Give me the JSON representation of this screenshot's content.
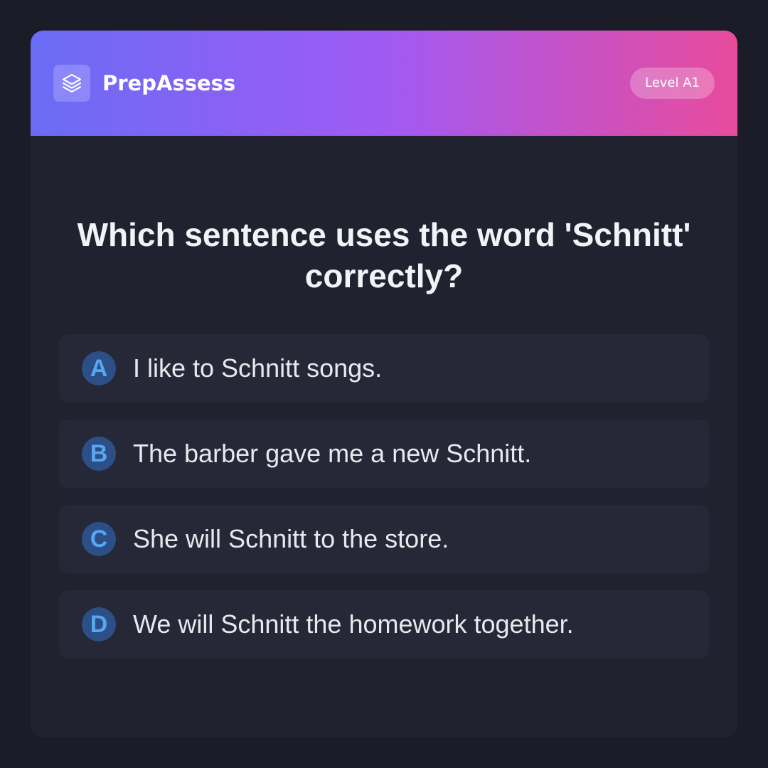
{
  "header": {
    "logo_icon": "layers-icon",
    "brand": "PrepAssess",
    "level": "Level A1",
    "gradient": [
      "#6a6cf5",
      "#a05af4",
      "#e84b9c"
    ]
  },
  "question": {
    "text": "Which sentence uses the word 'Schnitt' correctly?"
  },
  "options": [
    {
      "letter": "A",
      "text": "I like to Schnitt songs."
    },
    {
      "letter": "B",
      "text": "The barber gave me a new Schnitt."
    },
    {
      "letter": "C",
      "text": "She will Schnitt to the store."
    },
    {
      "letter": "D",
      "text": "We will Schnitt the homework together."
    }
  ],
  "colors": {
    "page_background": "#1b1c27",
    "card_background": "#20222f",
    "option_background": "#262837",
    "letter_badge": "#2b4f86",
    "letter_text": "#58a6f0"
  }
}
